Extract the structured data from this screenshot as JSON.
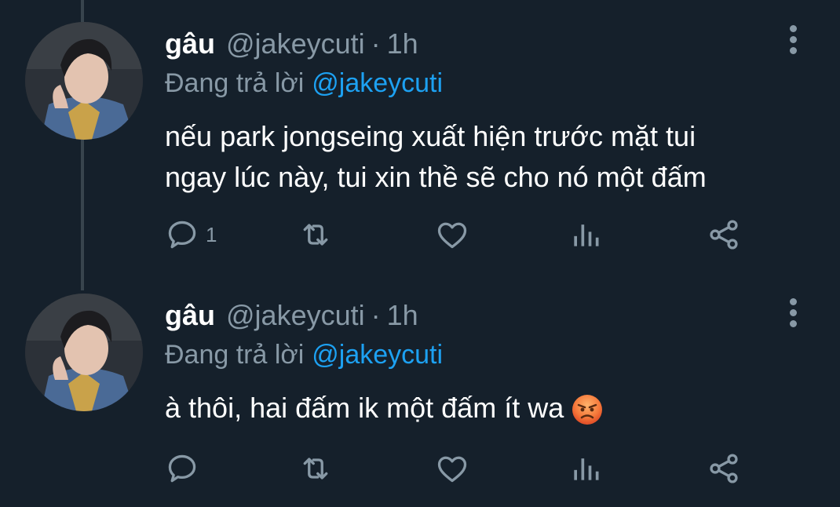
{
  "tweets": [
    {
      "name": "gâu",
      "handle": "@jakeycuti",
      "separator": "·",
      "time": "1h",
      "reply_prefix": "Đang trả lời",
      "reply_mention": "@jakeycuti",
      "text_line_1": "nếu park jongseing xuất hiện trước mặt tui",
      "text_line_2": "ngay lúc này, tui xin thề sẽ cho nó một đấm",
      "reply_count": "1",
      "emoji": ""
    },
    {
      "name": "gâu",
      "handle": "@jakeycuti",
      "separator": "·",
      "time": "1h",
      "reply_prefix": "Đang trả lời",
      "reply_mention": "@jakeycuti",
      "text_line_1": "à thôi, hai đấm ik một đấm ít wa",
      "reply_count": "",
      "emoji": "angry-face"
    }
  ],
  "icons": {
    "reply": "reply-icon",
    "retweet": "retweet-icon",
    "like": "heart-icon",
    "stats": "analytics-icon",
    "share": "share-icon",
    "more": "more-vertical-icon"
  },
  "colors": {
    "background": "#15202b",
    "secondary_text": "#8899a6",
    "mention": "#1da1f2",
    "thread_line": "#38444d"
  }
}
